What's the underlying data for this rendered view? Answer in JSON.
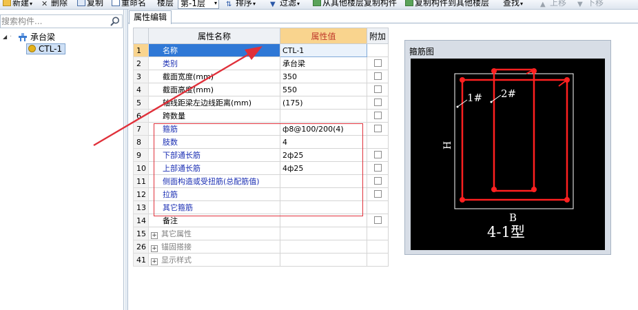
{
  "toolbar": {
    "new_label": "新建",
    "delete_label": "删除",
    "copy_label": "复制",
    "rename_label": "重命名",
    "floor_label": "楼层",
    "floor_value": "第-1层",
    "sort_label": "排序",
    "filter_label": "过滤",
    "copy_from_label": "从其他楼层复制构件",
    "copy_to_label": "复制构件到其他楼层",
    "find_label": "查找",
    "up_label": "上移",
    "down_label": "下移"
  },
  "search": {
    "placeholder": "搜索构件..."
  },
  "tree": {
    "root_label": "承台梁",
    "child_label": "CTL-1"
  },
  "tab": {
    "label": "属性编辑"
  },
  "grid": {
    "headers": {
      "name": "属性名称",
      "value": "属性值",
      "extra": "附加"
    },
    "rows": [
      {
        "num": "1",
        "name": "名称",
        "value": "CTL-1",
        "check": false,
        "style": "blue"
      },
      {
        "num": "2",
        "name": "类别",
        "value": "承台梁",
        "check": true,
        "style": "blue"
      },
      {
        "num": "3",
        "name": "截面宽度(mm)",
        "value": "350",
        "check": true,
        "style": "black"
      },
      {
        "num": "4",
        "name": "截面高度(mm)",
        "value": "550",
        "check": true,
        "style": "black"
      },
      {
        "num": "5",
        "name": "轴线距梁左边线距离(mm)",
        "value": "(175)",
        "check": true,
        "style": "black"
      },
      {
        "num": "6",
        "name": "跨数量",
        "value": "",
        "check": true,
        "style": "black"
      },
      {
        "num": "7",
        "name": "箍筋",
        "value": "ф8@100/200(4)",
        "check": true,
        "style": "blue"
      },
      {
        "num": "8",
        "name": "肢数",
        "value": "4",
        "check": false,
        "style": "blue"
      },
      {
        "num": "9",
        "name": "下部通长筋",
        "value": "2ф25",
        "check": true,
        "style": "blue"
      },
      {
        "num": "10",
        "name": "上部通长筋",
        "value": "4ф25",
        "check": true,
        "style": "blue"
      },
      {
        "num": "11",
        "name": "侧面构造或受扭筋(总配筋值)",
        "value": "",
        "check": true,
        "style": "blue"
      },
      {
        "num": "12",
        "name": "拉筋",
        "value": "",
        "check": true,
        "style": "blue"
      },
      {
        "num": "13",
        "name": "其它箍筋",
        "value": "",
        "check": false,
        "style": "blue"
      },
      {
        "num": "14",
        "name": "备注",
        "value": "",
        "check": true,
        "style": "black"
      },
      {
        "num": "15",
        "name": "其它属性",
        "value": "",
        "check": false,
        "style": "gray",
        "group": true
      },
      {
        "num": "26",
        "name": "锚固搭接",
        "value": "",
        "check": false,
        "style": "gray",
        "group": true
      },
      {
        "num": "41",
        "name": "显示样式",
        "value": "",
        "check": false,
        "style": "gray",
        "group": true
      }
    ]
  },
  "diagram": {
    "title": "箍筋图",
    "label_1": "1#",
    "label_2": "2#",
    "label_h": "H",
    "label_b": "B",
    "type_label": "4-1型"
  },
  "colors": {
    "selected_row": "#2f78d6",
    "header_value": "#f9d48e",
    "annotation": "#e0303a",
    "rebar": "#ff2020"
  }
}
